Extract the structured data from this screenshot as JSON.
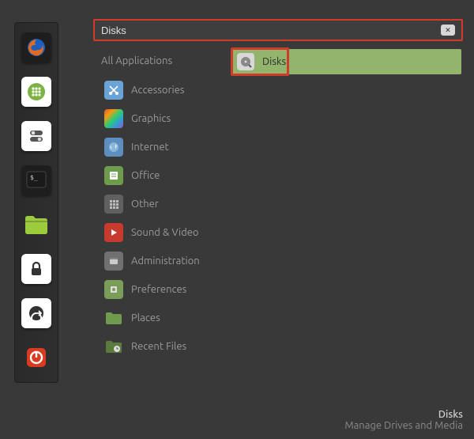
{
  "search": {
    "value": "Disks"
  },
  "header": {
    "all_applications": "All Applications"
  },
  "categories": [
    {
      "id": "accessories",
      "label": "Accessories",
      "icon": "scissors-icon",
      "color": "#6aa3d6"
    },
    {
      "id": "graphics",
      "label": "Graphics",
      "icon": "rainbow-icon",
      "color": "#3d3d3d"
    },
    {
      "id": "internet",
      "label": "Internet",
      "icon": "globe-icon",
      "color": "#5c8ebf"
    },
    {
      "id": "office",
      "label": "Office",
      "icon": "book-icon",
      "color": "#6f9b4d"
    },
    {
      "id": "other",
      "label": "Other",
      "icon": "grid-icon",
      "color": "#606060"
    },
    {
      "id": "sound-video",
      "label": "Sound & Video",
      "icon": "play-icon",
      "color": "#c73b2e"
    },
    {
      "id": "administration",
      "label": "Administration",
      "icon": "admin-icon",
      "color": "#606060"
    },
    {
      "id": "preferences",
      "label": "Preferences",
      "icon": "prefs-icon",
      "color": "#6f9b4d"
    },
    {
      "id": "places",
      "label": "Places",
      "icon": "folder-icon",
      "color": "#6f9b4d"
    },
    {
      "id": "recent-files",
      "label": "Recent Files",
      "icon": "folder-clock-icon",
      "color": "#5a7d3d"
    }
  ],
  "results": [
    {
      "id": "disks",
      "label": "Disks",
      "icon": "disks-icon"
    }
  ],
  "favorites": [
    {
      "id": "firefox",
      "icon": "firefox-icon",
      "color": "#e36b1f"
    },
    {
      "id": "apps",
      "icon": "apps-grid-icon",
      "color": "#7cb342"
    },
    {
      "id": "switch",
      "icon": "toggle-icon",
      "color": "#e8e8e8"
    },
    {
      "id": "terminal",
      "icon": "terminal-icon",
      "color": "#2b2b2b"
    },
    {
      "id": "files",
      "icon": "files-icon",
      "color": "#9ccc3c"
    },
    {
      "id": "lock",
      "icon": "lock-icon",
      "color": "#e8e8e8"
    },
    {
      "id": "logout",
      "icon": "logout-icon",
      "color": "#e8e8e8"
    },
    {
      "id": "power",
      "icon": "power-icon",
      "color": "#d83b1f"
    }
  ],
  "footer": {
    "title": "Disks",
    "subtitle": "Manage Drives and Media"
  }
}
